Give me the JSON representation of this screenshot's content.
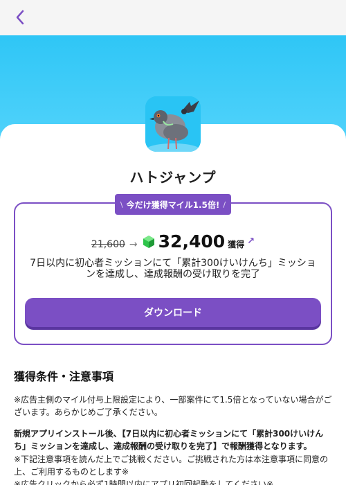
{
  "header": {
    "back_icon": "chevron-left-icon"
  },
  "colors": {
    "accent": "#7b4fc4",
    "hero_sky": "#2fc6f6",
    "gem": "#2ec44a"
  },
  "app": {
    "name": "ハトジャンプ",
    "icon": "pigeon-app-icon"
  },
  "offer": {
    "badge_text": "今だけ獲得マイル1.5倍!",
    "old_value": "21,600",
    "new_value": "32,400",
    "earn_label": "獲得",
    "mission": "7日以内に初心者ミッションにて「累計300けいけんち」ミッションを達成し、達成報酬の受け取りを完了",
    "download_label": "ダウンロード"
  },
  "conditions": {
    "title": "獲得条件・注意事項",
    "note1": "※広告主側のマイル付与上限設定により、一部案件にて1.5倍となっていない場合がございます。あらかじめご了承ください。",
    "note2": "新規アプリインストール後、【7日以内に初心者ミッションにて「累計300けいけんち」ミッションを達成し、達成報酬の受け取りを完了】で報酬獲得となります。",
    "note3": "※下記注意事項を読んだ上でご挑戦ください。ご挑戦された方は本注意事項に同意の上、ご利用するものとします※",
    "note4": "※広告クリックから必ず1時間以内にアプリ初回起動をしてください※"
  }
}
